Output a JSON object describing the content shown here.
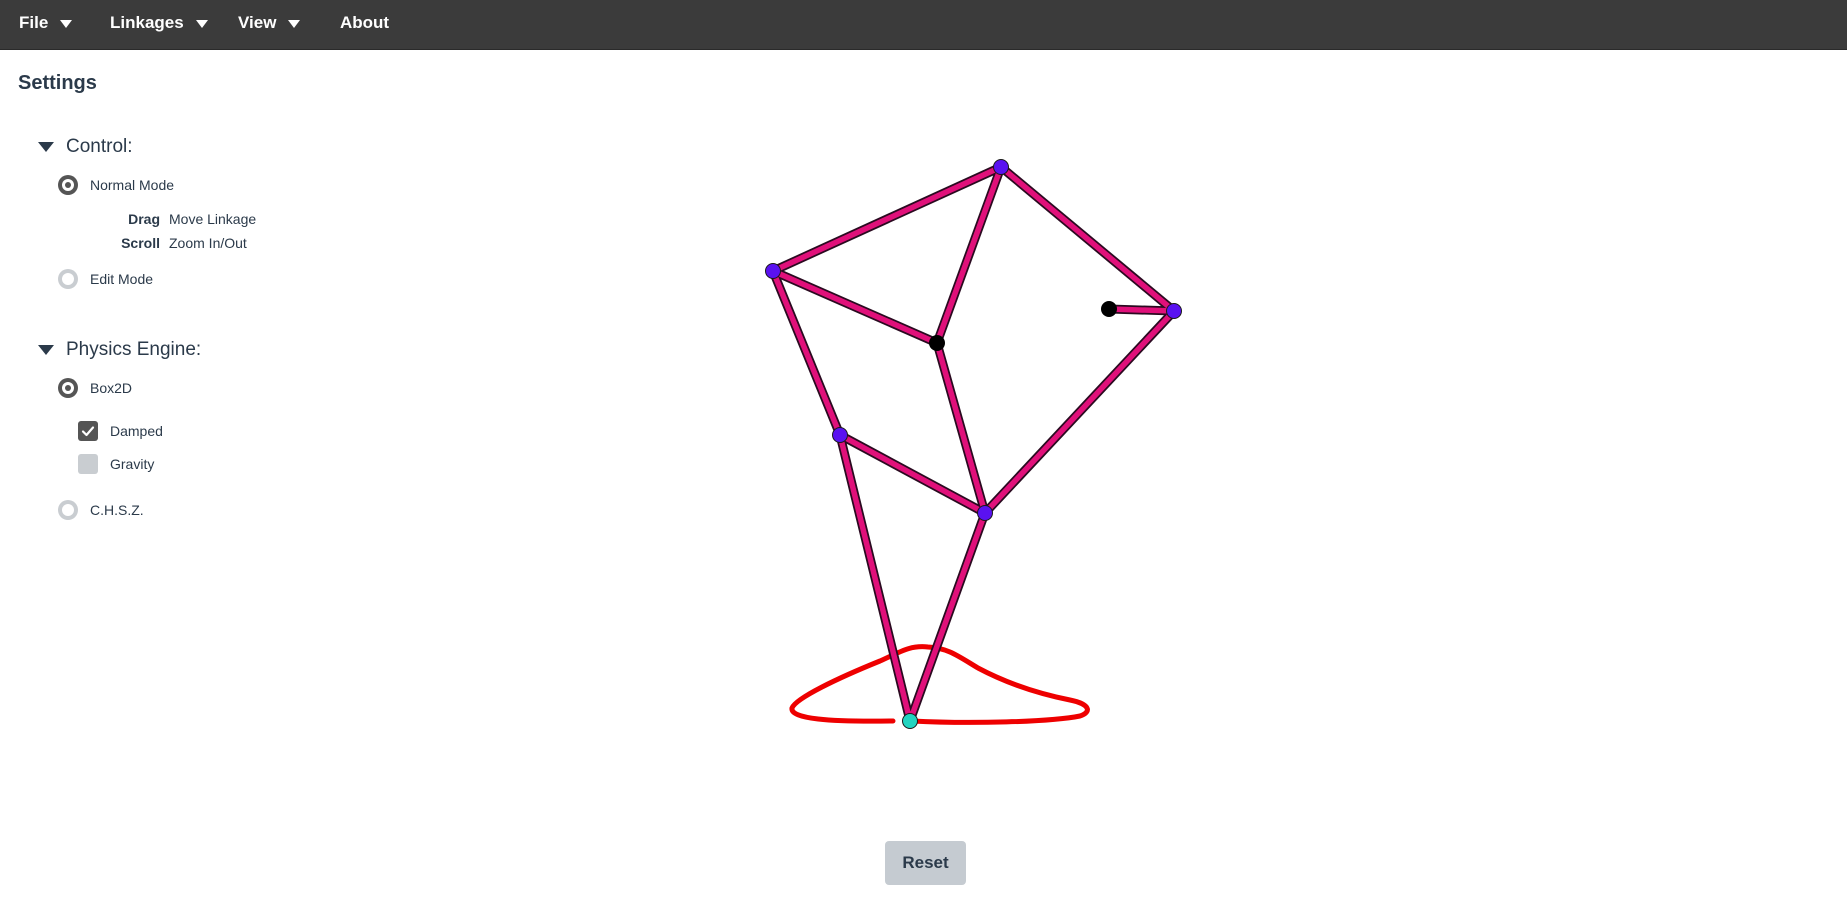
{
  "menubar": {
    "items": [
      {
        "label": "File",
        "has_dropdown": true
      },
      {
        "label": "Linkages",
        "has_dropdown": true
      },
      {
        "label": "View",
        "has_dropdown": true
      },
      {
        "label": "About",
        "has_dropdown": false
      }
    ]
  },
  "settings": {
    "title": "Settings",
    "control": {
      "header": "Control:",
      "normal_mode_label": "Normal Mode",
      "normal_mode_selected": true,
      "hints": [
        {
          "key": "Drag",
          "value": "Move Linkage"
        },
        {
          "key": "Scroll",
          "value": "Zoom In/Out"
        }
      ],
      "edit_mode_label": "Edit Mode",
      "edit_mode_selected": false
    },
    "physics": {
      "header": "Physics Engine:",
      "box2d_label": "Box2D",
      "box2d_selected": true,
      "damped_label": "Damped",
      "damped_checked": true,
      "gravity_label": "Gravity",
      "gravity_checked": false,
      "chsz_label": "C.H.S.Z.",
      "chsz_selected": false
    }
  },
  "linkage": {
    "colors": {
      "bar_fill": "#e0107a",
      "bar_outline": "#2a0a20",
      "joint_free": "#5a12f0",
      "joint_fixed": "#000000",
      "tracer_joint": "#22d4c0",
      "trace_path": "#ee0000"
    }
  },
  "reset_button": {
    "label": "Reset"
  },
  "icons": {
    "dropdown": "chevron-down-icon",
    "collapse": "triangle-down-icon",
    "check": "check-icon"
  }
}
